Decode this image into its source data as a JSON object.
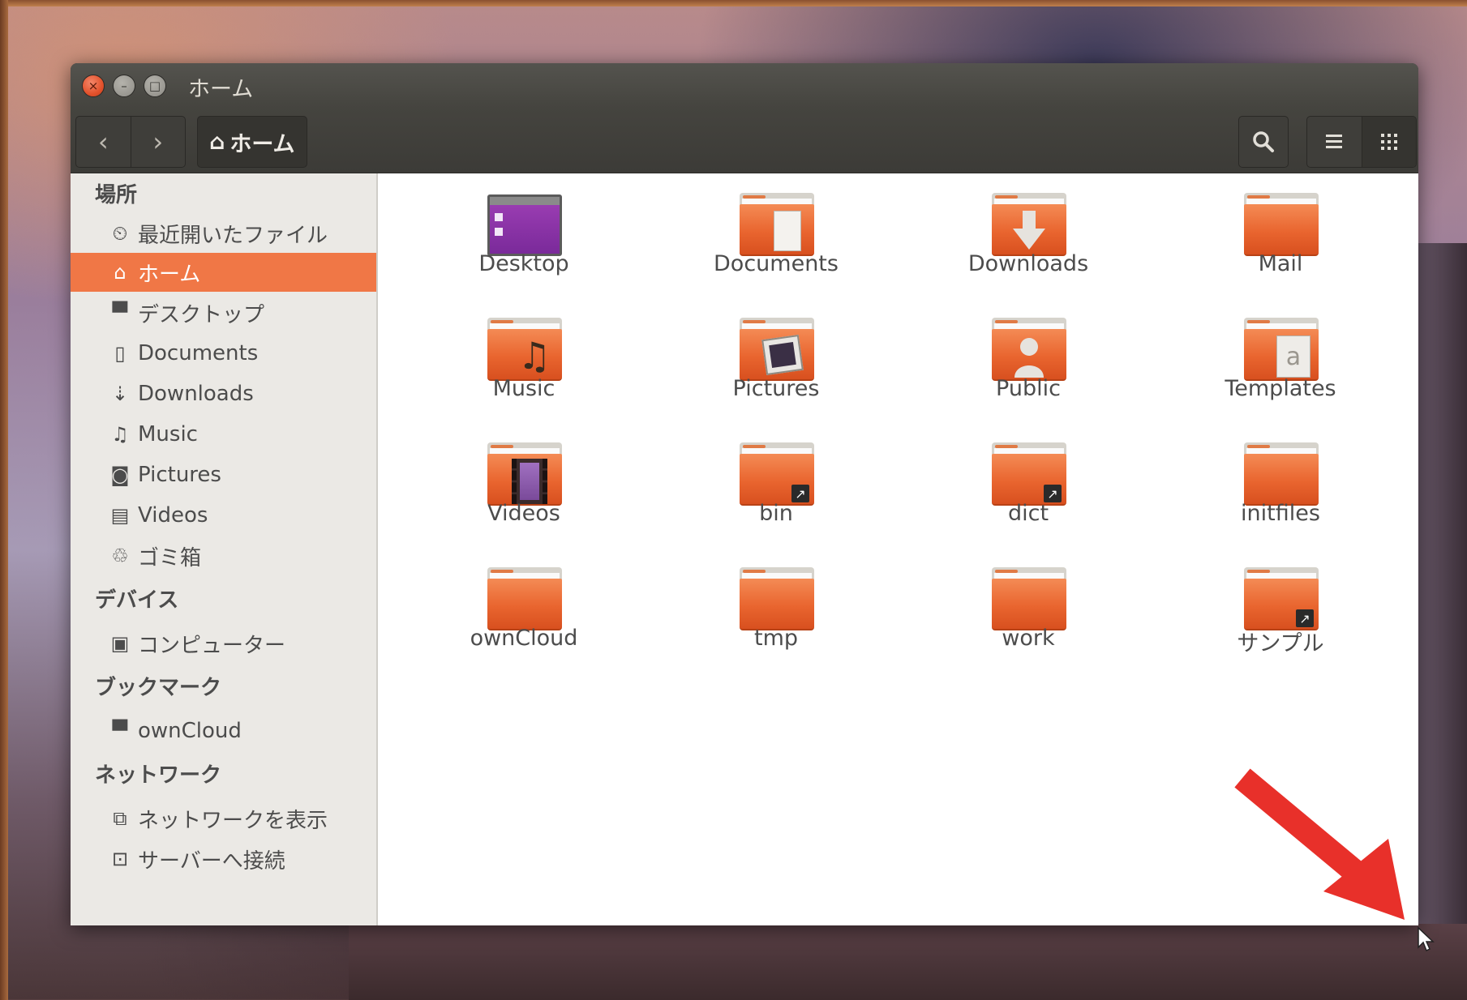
{
  "window": {
    "title": "ホーム",
    "controls": {
      "close": "×",
      "minimize": "–",
      "maximize": "□"
    }
  },
  "toolbar": {
    "back": "‹",
    "forward": "›",
    "path_home_icon": "⌂",
    "path_label": "ホーム",
    "search_icon": "search-icon",
    "list_view_icon": "list-icon",
    "grid_view_icon": "grid-icon"
  },
  "sidebar": {
    "places_title": "場所",
    "places": [
      {
        "label": "最近開いたファイル",
        "icon": "clock-icon",
        "glyph": "⏲"
      },
      {
        "label": "ホーム",
        "icon": "home-icon",
        "glyph": "⌂",
        "active": true
      },
      {
        "label": "デスクトップ",
        "icon": "folder-icon",
        "glyph": "▀"
      },
      {
        "label": "Documents",
        "icon": "document-icon",
        "glyph": "▯"
      },
      {
        "label": "Downloads",
        "icon": "download-icon",
        "glyph": "⇣"
      },
      {
        "label": "Music",
        "icon": "music-icon",
        "glyph": "♫"
      },
      {
        "label": "Pictures",
        "icon": "camera-icon",
        "glyph": "◙"
      },
      {
        "label": "Videos",
        "icon": "film-icon",
        "glyph": "▤"
      },
      {
        "label": "ゴミ箱",
        "icon": "trash-icon",
        "glyph": "♲"
      }
    ],
    "devices_title": "デバイス",
    "devices": [
      {
        "label": "コンピューター",
        "icon": "computer-icon",
        "glyph": "▣"
      }
    ],
    "bookmarks_title": "ブックマーク",
    "bookmarks": [
      {
        "label": "ownCloud",
        "icon": "folder-icon",
        "glyph": "▀"
      }
    ],
    "network_title": "ネットワーク",
    "network": [
      {
        "label": "ネットワークを表示",
        "icon": "network-icon",
        "glyph": "⧉"
      },
      {
        "label": "サーバーへ接続",
        "icon": "server-icon",
        "glyph": "⊡"
      }
    ]
  },
  "files": [
    {
      "name": "Desktop",
      "kind": "desktop"
    },
    {
      "name": "Documents",
      "kind": "documents"
    },
    {
      "name": "Downloads",
      "kind": "downloads"
    },
    {
      "name": "Mail",
      "kind": "folder"
    },
    {
      "name": "Music",
      "kind": "music"
    },
    {
      "name": "Pictures",
      "kind": "pictures"
    },
    {
      "name": "Public",
      "kind": "public"
    },
    {
      "name": "Templates",
      "kind": "templates"
    },
    {
      "name": "Videos",
      "kind": "videos"
    },
    {
      "name": "bin",
      "kind": "link"
    },
    {
      "name": "dict",
      "kind": "link"
    },
    {
      "name": "initfiles",
      "kind": "folder"
    },
    {
      "name": "ownCloud",
      "kind": "folder"
    },
    {
      "name": "tmp",
      "kind": "folder"
    },
    {
      "name": "work",
      "kind": "folder"
    },
    {
      "name": "サンプル",
      "kind": "link"
    }
  ],
  "colors": {
    "accent": "#f07746",
    "annotation_arrow": "#e8302a"
  }
}
